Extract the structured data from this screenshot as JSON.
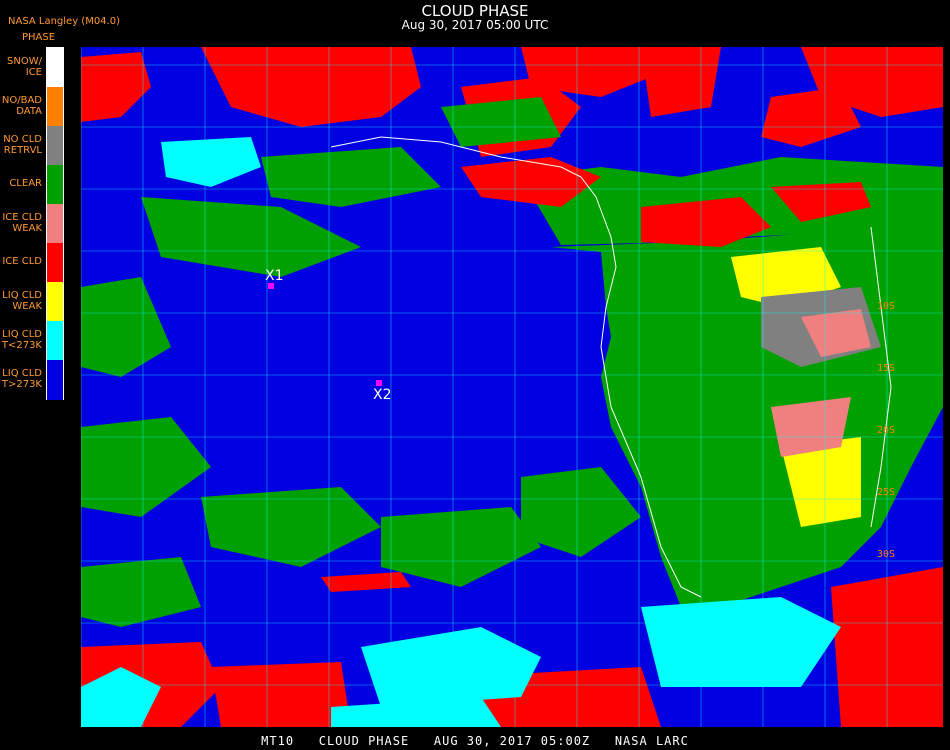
{
  "header": {
    "title": "CLOUD PHASE",
    "subtitle": "Aug 30, 2017 05:00 UTC",
    "credit": "NASA Langley (M04.0)"
  },
  "legend": {
    "heading": "PHASE",
    "items": [
      {
        "label": "SNOW/\nICE",
        "color": "#ffffff"
      },
      {
        "label": "NO/BAD\nDATA",
        "color": "#ff7f00"
      },
      {
        "label": "NO CLD\nRETRVL",
        "color": "#808080"
      },
      {
        "label": "CLEAR",
        "color": "#00a000"
      },
      {
        "label": "ICE CLD\nWEAK",
        "color": "#f08080"
      },
      {
        "label": "ICE CLD",
        "color": "#ff0000"
      },
      {
        "label": "LIQ CLD\nWEAK",
        "color": "#ffff00"
      },
      {
        "label": "LIQ CLD\nT<273K",
        "color": "#00ffff"
      },
      {
        "label": "LIQ CLD\nT>273K",
        "color": "#0000e0"
      }
    ]
  },
  "map": {
    "colors": {
      "ocean": "#0000e0",
      "ice_cloud": "#ff0000",
      "clear": "#00a000",
      "liquid_cold": "#00ffff",
      "liquid_weak": "#ffff00",
      "ice_weak": "#f08080",
      "no_retrieval": "#808080",
      "grid": "#00ffff",
      "coast": "#ffffff",
      "marker": "#ff00ff"
    },
    "markers": [
      {
        "label": "X1"
      },
      {
        "label": "X2"
      }
    ],
    "lat_labels": [
      "10S",
      "15S",
      "20S",
      "25S",
      "30S"
    ]
  },
  "footer": {
    "text": "MT10   CLOUD PHASE   AUG 30, 2017 05:00Z   NASA LARC"
  }
}
